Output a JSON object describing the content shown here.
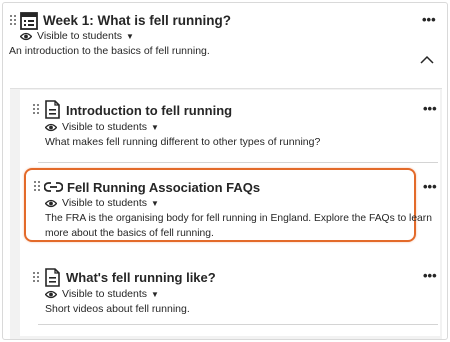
{
  "week": {
    "title": "Week 1: What is fell running?",
    "visibility": "Visible to students",
    "description": "An introduction to the basics of fell running."
  },
  "items": [
    {
      "title": "Introduction to fell running",
      "visibility": "Visible to students",
      "description": "What makes fell running different to other types of running?",
      "icon": "document-icon"
    },
    {
      "title": "Fell Running Association FAQs",
      "visibility": "Visible to students",
      "description_line1": "The FRA is the organising body for fell running in England. Explore the FAQs to learn",
      "description_line2": "more about the basics of fell running.",
      "icon": "link-icon"
    },
    {
      "title": "What's fell running like?",
      "visibility": "Visible to students",
      "description": "Short videos about fell running.",
      "icon": "document-icon"
    }
  ],
  "more_label": "•••",
  "colors": {
    "highlight": "#e36a2a",
    "panel": "#f2f2f2"
  }
}
